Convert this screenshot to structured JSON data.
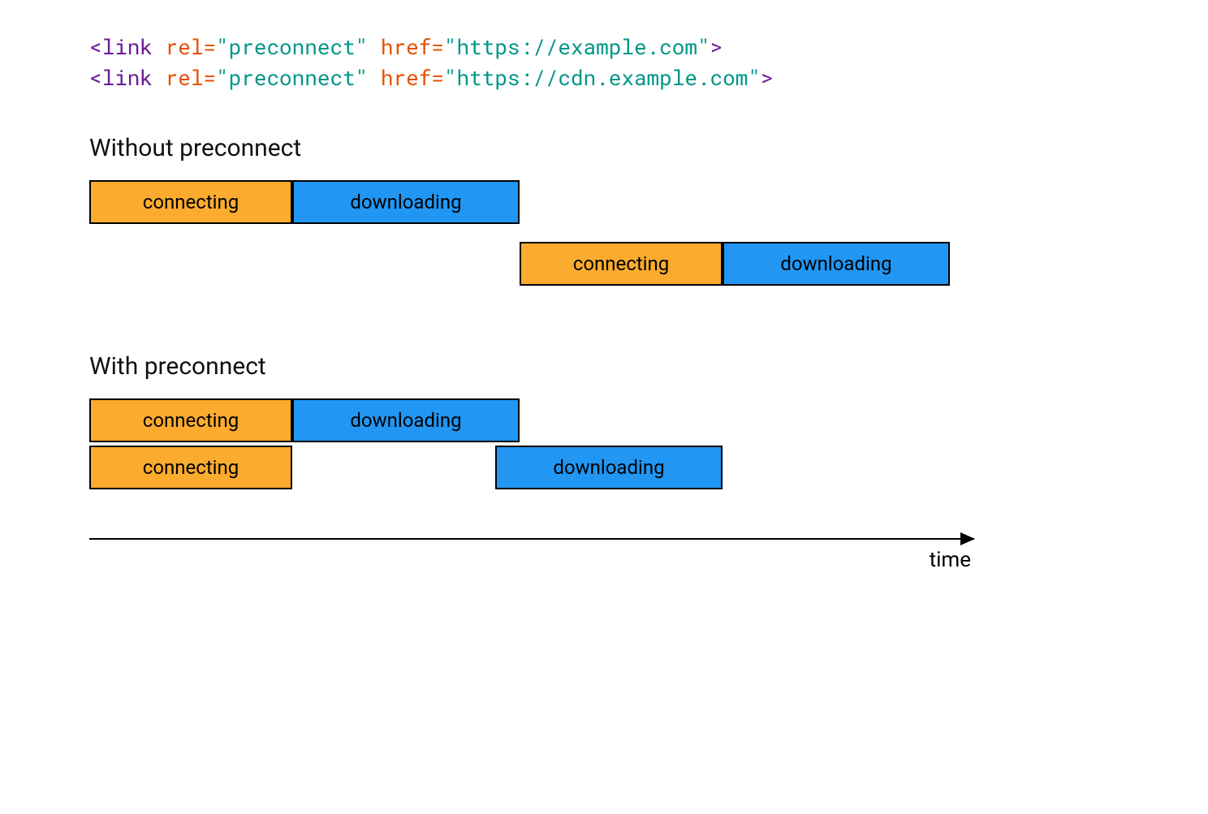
{
  "code": {
    "line1": {
      "open": "<link ",
      "rel_attr": "rel=",
      "rel_val": "\"preconnect\" ",
      "href_attr": "href=",
      "href_val": "\"https://example.com\"",
      "close": ">"
    },
    "line2": {
      "open": "<link ",
      "rel_attr": "rel=",
      "rel_val": "\"preconnect\" ",
      "href_attr": "href=",
      "href_val": "\"https://cdn.example.com\"",
      "close": ">"
    }
  },
  "sections": {
    "without": {
      "heading": "Without preconnect",
      "row1_connect": "connecting",
      "row1_download": "downloading",
      "row2_connect": "connecting",
      "row2_download": "downloading"
    },
    "with": {
      "heading": "With preconnect",
      "row1_connect": "connecting",
      "row1_download": "downloading",
      "row2_connect": "connecting",
      "row2_download": "downloading"
    }
  },
  "axis": {
    "label": "time"
  },
  "colors": {
    "connecting": "#fbab2e",
    "downloading": "#2196f3",
    "code_purple": "#6a1b9a",
    "code_orange": "#e65100",
    "code_teal": "#009688"
  },
  "chart_data": {
    "type": "gantt",
    "unit": "relative-time",
    "without_preconnect": [
      {
        "resource": 1,
        "phase": "connecting",
        "start": 0,
        "end": 1
      },
      {
        "resource": 1,
        "phase": "downloading",
        "start": 1,
        "end": 2
      },
      {
        "resource": 2,
        "phase": "connecting",
        "start": 2,
        "end": 3
      },
      {
        "resource": 2,
        "phase": "downloading",
        "start": 3,
        "end": 4
      }
    ],
    "with_preconnect": [
      {
        "resource": 1,
        "phase": "connecting",
        "start": 0,
        "end": 1
      },
      {
        "resource": 1,
        "phase": "downloading",
        "start": 1,
        "end": 2
      },
      {
        "resource": 2,
        "phase": "connecting",
        "start": 0,
        "end": 1
      },
      {
        "resource": 2,
        "phase": "downloading",
        "start": 2,
        "end": 3
      }
    ],
    "x_range": [
      0,
      4.2
    ],
    "xlabel": "time"
  }
}
